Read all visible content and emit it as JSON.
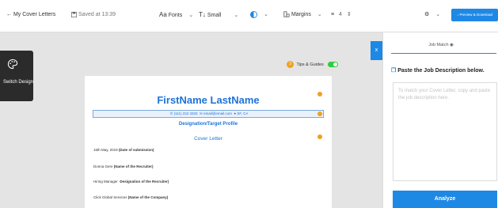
{
  "toolbar": {
    "back_label": "My Cover Letters",
    "saved_label": "Saved at 13:39",
    "fonts_label": "Fonts",
    "size_label": "Small",
    "margins_label": "Margins",
    "spacing_value": "4",
    "download_label": "Preview & Download",
    "accent_color": "#1e88e5"
  },
  "switch_design": {
    "label": "Switch Design"
  },
  "tips": {
    "count": "3",
    "label": "Tips & Guides"
  },
  "document": {
    "name": "FirstName LastName",
    "phone": "(111) 222 3333",
    "email": "email@email.com",
    "location": "SF, CA",
    "role": "Designation/Target Profile",
    "cover_title": "Cover Letter",
    "lines": [
      {
        "text": "15th May, 2019 ",
        "bold": "(Date of submission)"
      },
      {
        "text": "Donna Gere ",
        "bold": "(Name of the Recruiter)"
      },
      {
        "text": "Hiring Manager -",
        "bold": "Designation of the Recruiter)"
      },
      {
        "text": "Click Global Services ",
        "bold": "(Name of the Company)"
      }
    ],
    "name_color": "#1e73d9"
  },
  "right_panel": {
    "tab_label": "Job Match",
    "heading": "Paste the Job Description below.",
    "placeholder": "To match your Cover Letter, copy and paste the job description here.",
    "analyze_label": "Analyze",
    "close_label": "x"
  }
}
